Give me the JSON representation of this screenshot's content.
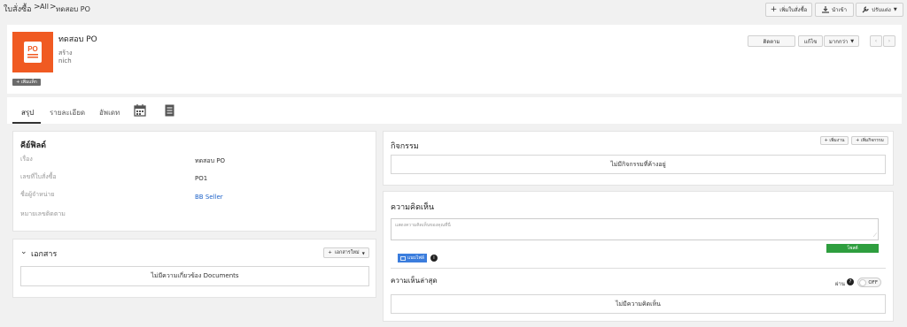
{
  "breadcrumb": {
    "root": "ใบสั่งซื้อ",
    "sep": ">",
    "all": "All",
    "current": "ทดสอบ PO"
  },
  "toolbar": {
    "add_po": "เพิ่มใบสั่งซื้อ",
    "import": "นำเข้า",
    "customize": "ปรับแต่ง"
  },
  "header": {
    "title": "ทดสอบ PO",
    "sub1": "สร้าง",
    "sub2": "nich",
    "add_tag": "+ เพิ่มแท็ก",
    "follow": "ติดตาม",
    "edit": "แก้ไข",
    "more": "มากกว่า",
    "brand_color": "#f05a22"
  },
  "tabs": {
    "summary": "สรุป",
    "detail": "รายละเอียด",
    "update": "อัพเดท"
  },
  "key_fields": {
    "title": "คีย์ฟิลด์",
    "rows": [
      {
        "label": "เรื่อง",
        "value": "ทดสอบ PO"
      },
      {
        "label": "เลขที่ใบสั่งซื้อ",
        "value": "PO1"
      },
      {
        "label": "ชื่อผู้จำหน่าย",
        "value": "BB Seller"
      },
      {
        "label": "หมายเลขติดตาม",
        "value": ""
      }
    ]
  },
  "documents": {
    "title": "เอกสาร",
    "new_doc": "เอกสารใหม่",
    "empty": "ไม่มีความเกี่ยวข้อง Documents"
  },
  "activities": {
    "title": "กิจกรรม",
    "add_event": "+ เพิ่มงาน",
    "add_activity": "+ เพิ่มกิจกรรม",
    "empty": "ไม่มีกิจกรรมที่ค้างอยู่"
  },
  "comments": {
    "title": "ความคิดเห็น",
    "placeholder": "แสดงความคิดเห็นของคุณที่นี่",
    "post": "โพสต์",
    "attach": "แนบไฟล์",
    "latest": "ความเห็นล่าสุด",
    "toggle_label": "ผ่าน",
    "toggle_state": "OFF",
    "empty": "ไม่มีความคิดเห็น",
    "post_color": "#2e9e3e"
  }
}
